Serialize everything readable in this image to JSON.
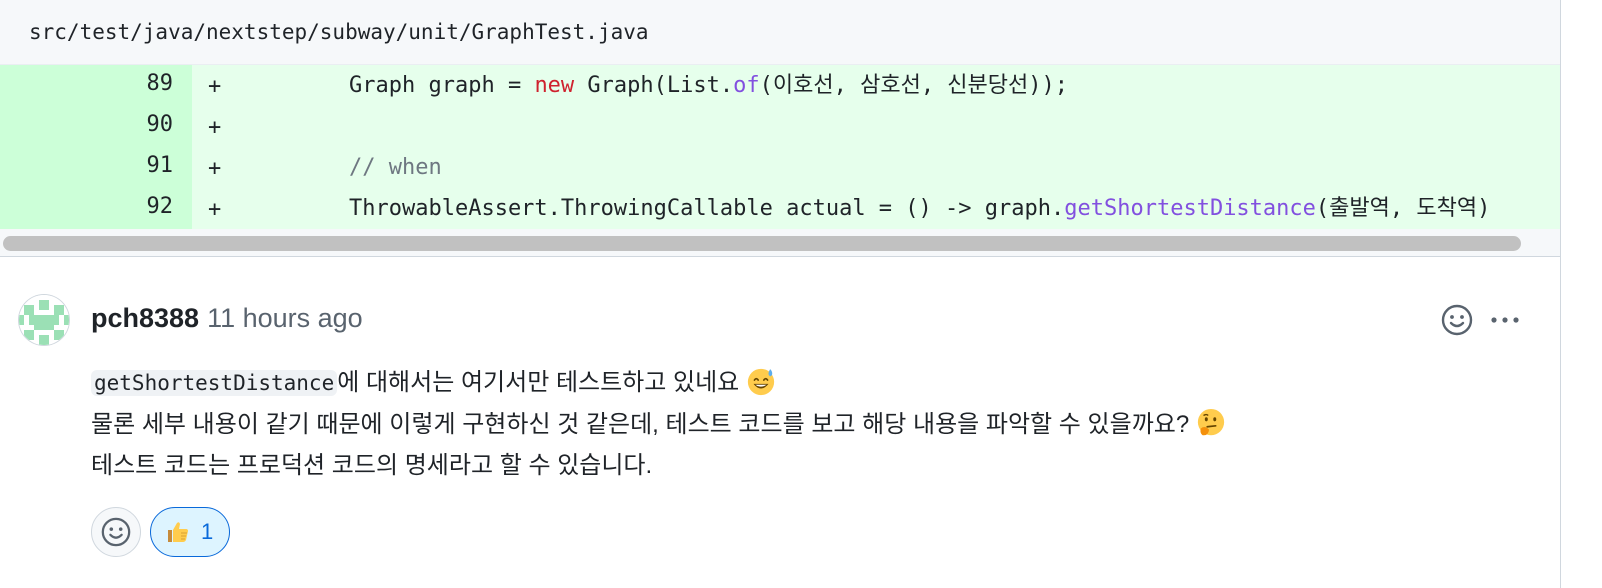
{
  "file": {
    "path": "src/test/java/nextstep/subway/unit/GraphTest.java"
  },
  "diff_lines": [
    {
      "number": "89",
      "marker": "+",
      "c1": "Graph graph = ",
      "c2": "new",
      "c3": " Graph(List.",
      "c4": "of",
      "c5": "(이호선, 삼호선, 신분당선));"
    },
    {
      "number": "90",
      "marker": "+"
    },
    {
      "number": "91",
      "marker": "+",
      "comment": "// when"
    },
    {
      "number": "92",
      "marker": "+",
      "c1": "ThrowableAssert.ThrowingCallable actual = () -> graph.",
      "c2": "getShortestDistance",
      "c3": "(출발역, 도착역)"
    }
  ],
  "comment": {
    "author": "pch8388",
    "time": "11 hours ago",
    "line1_code": "getShortestDistance",
    "line1_text": "에 대해서는 여기서만 테스트하고 있네요",
    "line1_emoji": "grinning-sweat-emoji",
    "line2_text": "물론 세부 내용이 같기 때문에 이렇게 구현하신 것 같은데, 테스트 코드를 보고 해당 내용을 파악할 수 있을까요?",
    "line2_emoji": "thinking-face-emoji",
    "line3_text": "테스트 코드는 프로덕션 코드의 명세라고 할 수 있습니다."
  },
  "reactions": [
    {
      "icon": "thumbs-up-icon",
      "count": "1"
    }
  ],
  "colors": {
    "addition_bg": "#e6ffec",
    "addition_gutter": "#ccffd8",
    "keyword": "#cf222e",
    "method": "#8250df",
    "link": "#0969da"
  }
}
